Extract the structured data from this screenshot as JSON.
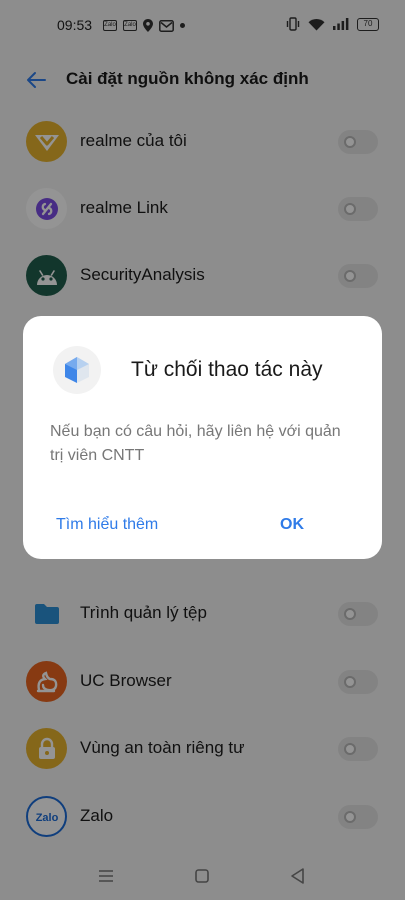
{
  "status_bar": {
    "time": "09:53",
    "left_badges": [
      "Zalo",
      "Zalo"
    ],
    "battery": "70"
  },
  "header": {
    "title": "Cài đặt nguồn không xác định"
  },
  "apps": [
    {
      "label": "realme của tôi",
      "icon": "heart-badge-icon",
      "icon_color": "#e6b12e",
      "enabled": false
    },
    {
      "label": "realme Link",
      "icon": "link-icon",
      "icon_color": "#ffffff",
      "enabled": false
    },
    {
      "label": "SecurityAnalysis",
      "icon": "android-icon",
      "icon_color": "#1f5e4c",
      "enabled": false
    },
    {
      "label": "Trình quản lý tệp",
      "icon": "folder-icon",
      "icon_color": "#2b8fd6",
      "enabled": false
    },
    {
      "label": "UC Browser",
      "icon": "squirrel-icon",
      "icon_color": "#e8641f",
      "enabled": false
    },
    {
      "label": "Vùng an toàn riêng tư",
      "icon": "lock-icon",
      "icon_color": "#e6b12e",
      "enabled": false
    },
    {
      "label": "Zalo",
      "icon": "zalo-icon",
      "icon_color": "#ffffff",
      "enabled": false
    }
  ],
  "dialog": {
    "title": "Từ chối thao tác này",
    "message": "Nếu bạn có câu hỏi, hãy liên hệ với quản trị viên CNTT",
    "learn_more": "Tìm hiểu thêm",
    "ok": "OK",
    "accent": "#2f7be8"
  }
}
